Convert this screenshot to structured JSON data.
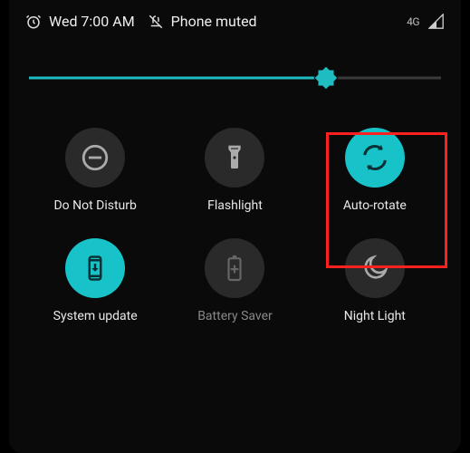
{
  "statusbar": {
    "alarm_time": "Wed 7:00 AM",
    "mute_label": "Phone muted",
    "network_label": "4G"
  },
  "brightness": {
    "percent": 72
  },
  "tiles": [
    {
      "id": "dnd",
      "label": "Do Not Disturb",
      "active": false
    },
    {
      "id": "flashlight",
      "label": "Flashlight",
      "active": false
    },
    {
      "id": "autorotate",
      "label": "Auto-rotate",
      "active": true,
      "highlighted": true
    },
    {
      "id": "systemupdate",
      "label": "System update",
      "active": true
    },
    {
      "id": "batterysaver",
      "label": "Battery Saver",
      "active": false,
      "dim": true
    },
    {
      "id": "nightlight",
      "label": "Night Light",
      "active": false
    }
  ],
  "colors": {
    "accent": "#17c3c9",
    "highlight": "#ff2020"
  }
}
